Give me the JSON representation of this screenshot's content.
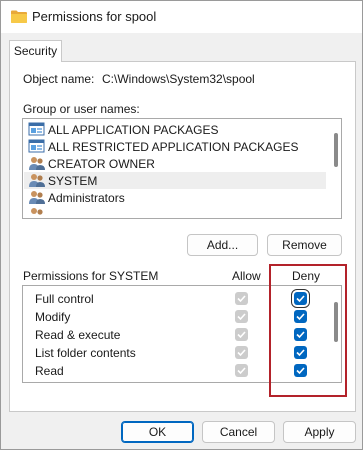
{
  "window": {
    "title": "Permissions for spool"
  },
  "tabs": [
    {
      "label": "Security"
    }
  ],
  "object": {
    "label": "Object name:",
    "value": "C:\\Windows\\System32\\spool"
  },
  "groups": {
    "label": "Group or user names:",
    "items": [
      {
        "name": "ALL APPLICATION PACKAGES",
        "icon": "package-group-icon"
      },
      {
        "name": "ALL RESTRICTED APPLICATION PACKAGES",
        "icon": "package-group-icon"
      },
      {
        "name": "CREATOR OWNER",
        "icon": "users-icon"
      },
      {
        "name": "SYSTEM",
        "icon": "users-icon",
        "selected": true
      },
      {
        "name": "Administrators",
        "icon": "users-icon"
      }
    ]
  },
  "buttons": {
    "add": "Add...",
    "remove": "Remove",
    "ok": "OK",
    "cancel": "Cancel",
    "apply": "Apply"
  },
  "permissions": {
    "header": "Permissions for SYSTEM",
    "allow_label": "Allow",
    "deny_label": "Deny",
    "rows": [
      {
        "name": "Full control",
        "allow": true,
        "allow_enabled": false,
        "deny": true
      },
      {
        "name": "Modify",
        "allow": true,
        "allow_enabled": false,
        "deny": true
      },
      {
        "name": "Read & execute",
        "allow": true,
        "allow_enabled": false,
        "deny": true
      },
      {
        "name": "List folder contents",
        "allow": true,
        "allow_enabled": false,
        "deny": true
      },
      {
        "name": "Read",
        "allow": true,
        "allow_enabled": false,
        "deny": true
      }
    ]
  },
  "colors": {
    "accent": "#0067c0",
    "highlight": "#b3222a",
    "disabled_check": "#cccccc"
  }
}
